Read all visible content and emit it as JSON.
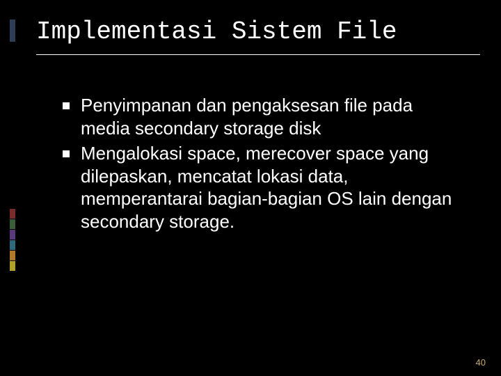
{
  "slide": {
    "title": "Implementasi Sistem File",
    "bullets": [
      "Penyimpanan dan pengaksesan file pada media secondary storage disk",
      "Mengalokasi space, merecover space yang dilepaskan, mencatat lokasi data, memperantarai bagian-bagian OS lain dengan secondary storage."
    ],
    "page_number": "40",
    "accent_colors": {
      "top": "#2f3e57",
      "c1": "#7a2c2c",
      "c2": "#3a5e3a",
      "c3": "#5a3a7a",
      "c4": "#2f6a7a",
      "c5": "#b07a2a",
      "c6": "#b0a12a"
    }
  }
}
